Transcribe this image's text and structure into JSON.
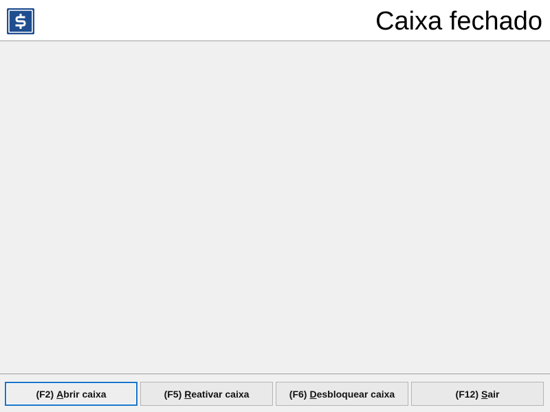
{
  "header": {
    "logo_icon": "dollar-sign-icon",
    "title": "Caixa fechado"
  },
  "colors": {
    "logo_blue": "#1f4d8f",
    "focus_border": "#1a73c9",
    "background": "#f0f0f0"
  },
  "footer": {
    "buttons": [
      {
        "key": "(F2)",
        "accel": "A",
        "rest": "brir caixa",
        "focused": true
      },
      {
        "key": "(F5)",
        "accel": "R",
        "rest": "eativar caixa",
        "focused": false
      },
      {
        "key": "(F6)",
        "accel": "D",
        "rest": "esbloquear caixa",
        "focused": false
      },
      {
        "key": "(F12)",
        "accel": "S",
        "rest": "air",
        "focused": false
      }
    ]
  }
}
